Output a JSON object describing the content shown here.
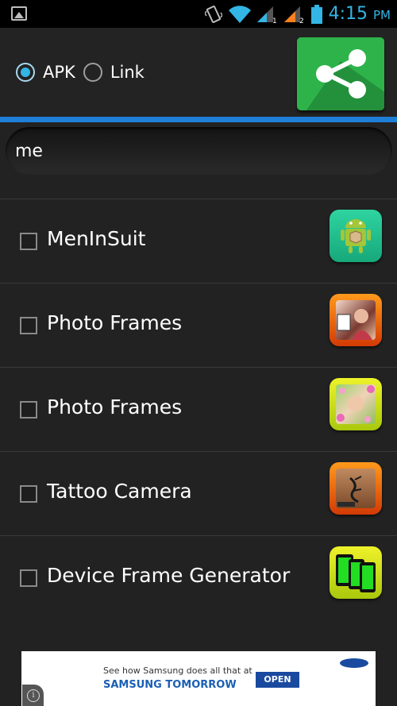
{
  "status_bar": {
    "time": "4:15",
    "ampm": "PM",
    "icons": [
      "gallery-icon",
      "vibrate-icon",
      "wifi-icon",
      "signal-sim1-icon",
      "signal-sim2-icon",
      "battery-icon"
    ]
  },
  "header": {
    "radio_options": [
      {
        "label": "APK",
        "checked": true
      },
      {
        "label": "Link",
        "checked": false
      }
    ],
    "share_button_icon": "share-icon",
    "share_button_color": "#2eb34a"
  },
  "accent_color": "#1e7fd6",
  "search": {
    "value": "me"
  },
  "apps": [
    {
      "label": "MenInSuit",
      "checked": false,
      "icon": "android-box-icon"
    },
    {
      "label": "Photo Frames",
      "checked": false,
      "icon": "photo-frames-icon"
    },
    {
      "label": "Photo Frames",
      "checked": false,
      "icon": "floral-photo-frames-icon"
    },
    {
      "label": "Tattoo Camera",
      "checked": false,
      "icon": "tattoo-camera-icon"
    },
    {
      "label": "Device Frame Generator",
      "checked": false,
      "icon": "device-frames-icon"
    }
  ],
  "ad": {
    "line1": "See how Samsung does all that at",
    "line2": "SAMSUNG TOMORROW",
    "button": "OPEN",
    "brand": "SAMSUNG",
    "info_icon": "info-icon"
  }
}
